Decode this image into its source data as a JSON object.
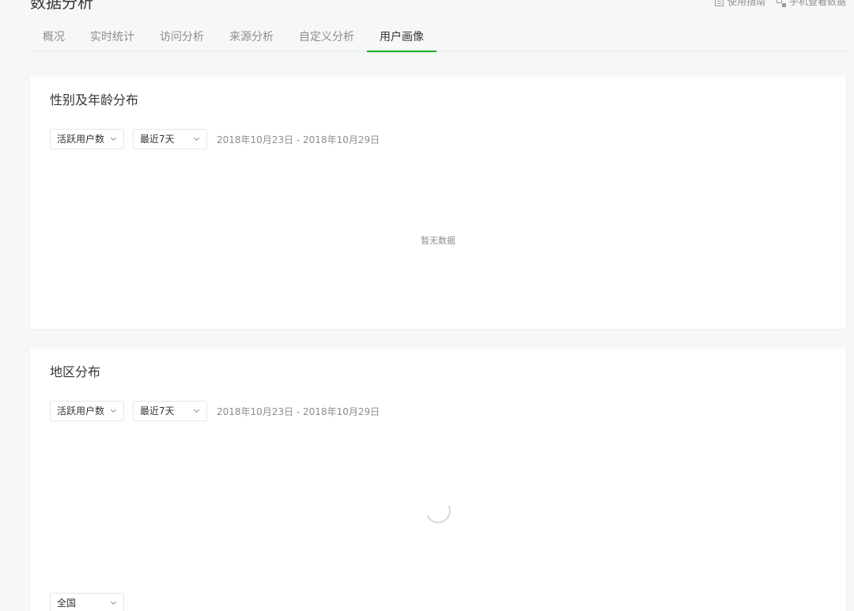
{
  "header": {
    "title": "数据分析",
    "links": [
      {
        "label": "使用指南",
        "icon": "document-icon"
      },
      {
        "label": "手机查看数据",
        "icon": "qr-code-icon"
      }
    ]
  },
  "tabs": [
    {
      "label": "概况"
    },
    {
      "label": "实时统计"
    },
    {
      "label": "访问分析"
    },
    {
      "label": "来源分析"
    },
    {
      "label": "自定义分析"
    },
    {
      "label": "用户画像",
      "active": true
    }
  ],
  "accent_color": "#1aad19",
  "gender_age_card": {
    "title": "性别及年龄分布",
    "metric_select": "活跃用户数",
    "period_select": "最近7天",
    "date_range": "2018年10月23日 - 2018年10月29日",
    "empty_text": "暂无数据"
  },
  "region_card": {
    "title": "地区分布",
    "metric_select": "活跃用户数",
    "period_select": "最近7天",
    "date_range": "2018年10月23日 - 2018年10月29日",
    "region_select": "全国",
    "loading": true
  }
}
